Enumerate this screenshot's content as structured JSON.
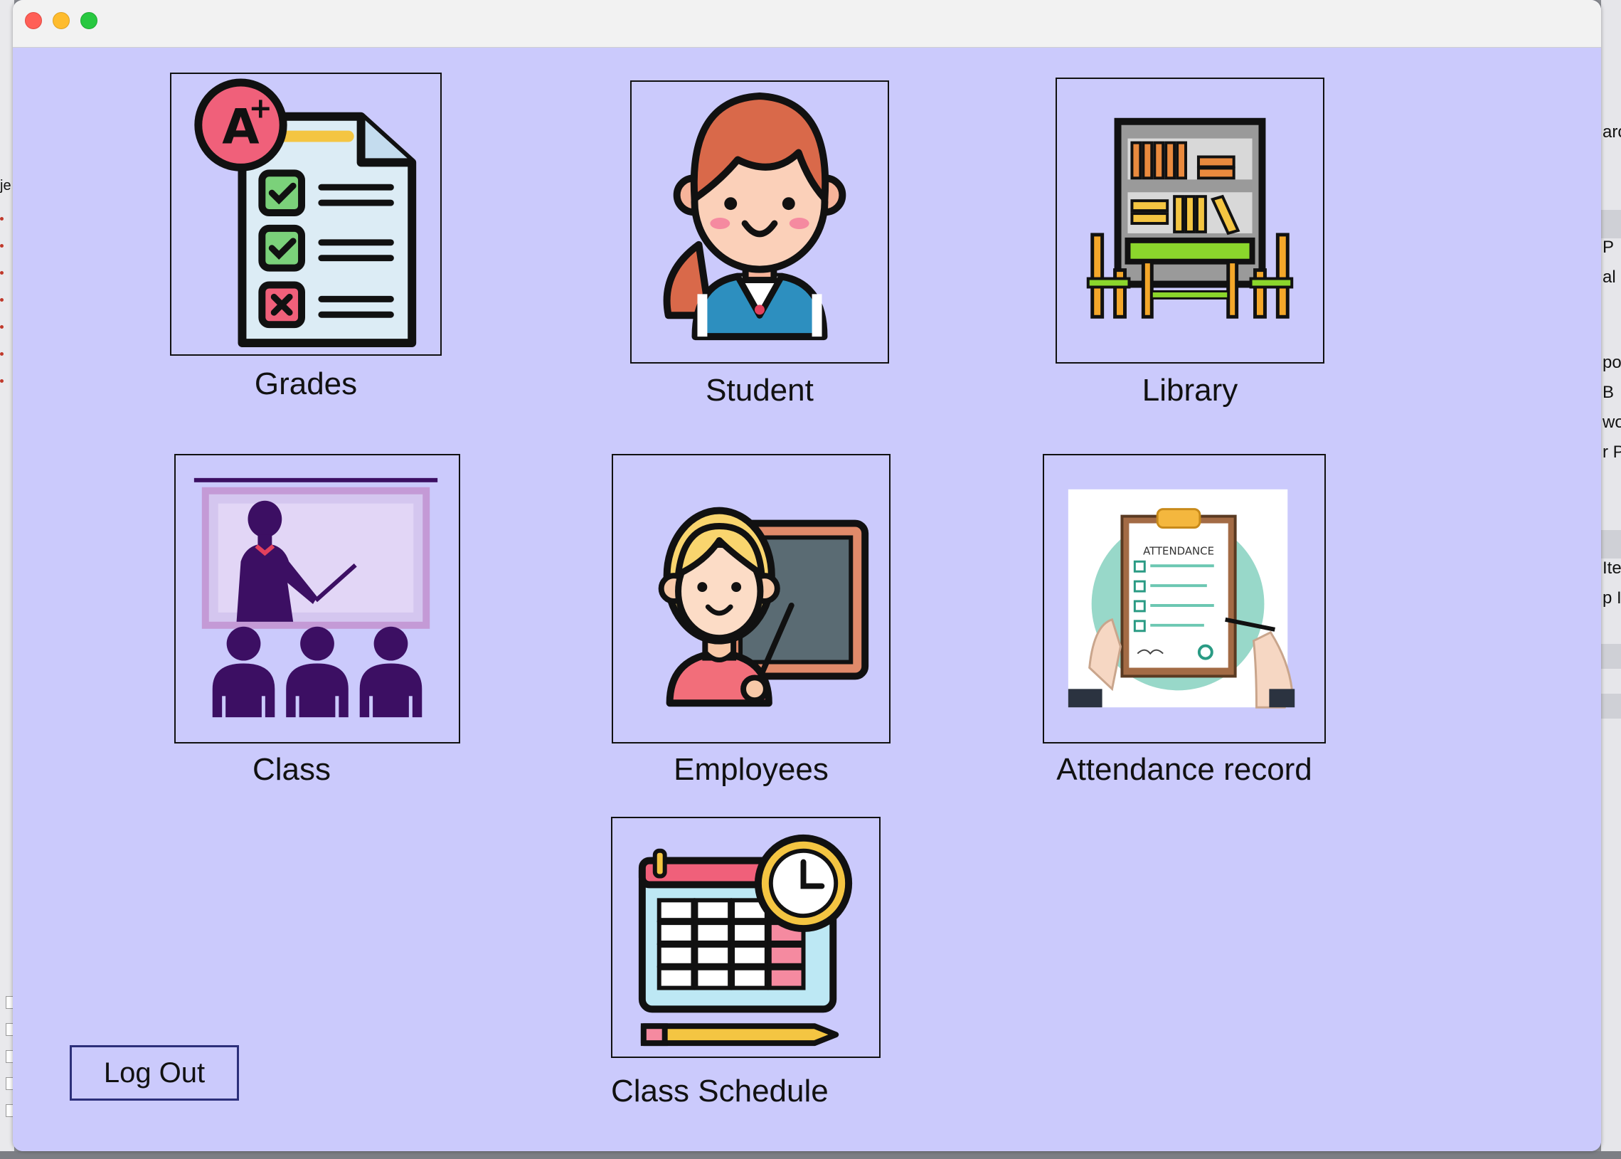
{
  "window": {
    "title": ""
  },
  "tiles": [
    {
      "label": "Grades",
      "icon": "grades-report-icon"
    },
    {
      "label": "Student",
      "icon": "student-avatar-icon"
    },
    {
      "label": "Library",
      "icon": "library-bookshelf-icon"
    },
    {
      "label": "Class",
      "icon": "classroom-teacher-icon"
    },
    {
      "label": "Employees",
      "icon": "teacher-blackboard-icon"
    },
    {
      "label": "Attendance record",
      "icon": "attendance-clipboard-icon"
    },
    {
      "label": "Class Schedule",
      "icon": "calendar-clock-icon"
    }
  ],
  "logout": {
    "label": "Log Out"
  },
  "attendance_sheet_title": "ATTENDANCE",
  "background_fragments": {
    "left": [
      "je"
    ],
    "right": [
      "arc",
      "P",
      "al",
      "po",
      "B",
      "wo",
      "r P",
      "Ite",
      "p I"
    ]
  },
  "colors": {
    "window_background": "#cbcafc",
    "tile_border": "#111111",
    "logout_border": "#2c2f7a"
  }
}
